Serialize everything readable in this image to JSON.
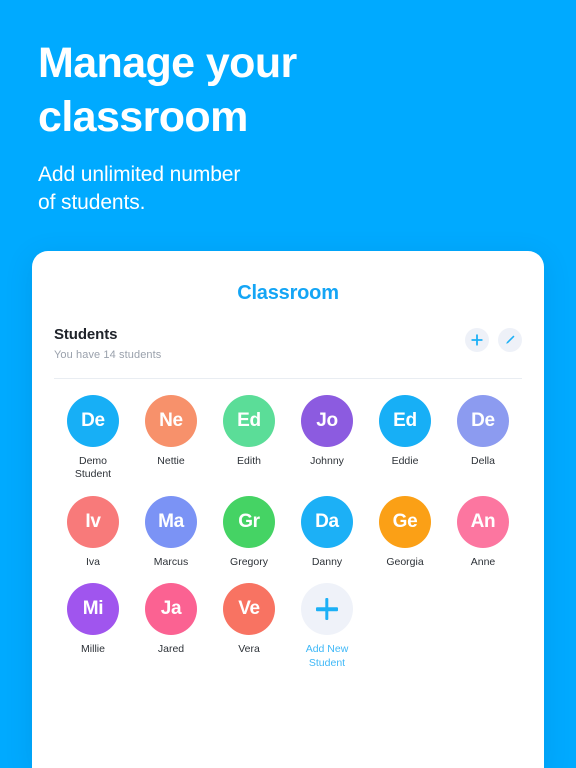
{
  "theme": {
    "background": "#00AAFF",
    "card_background": "#FFFFFF",
    "accent": "#14A5F5",
    "muted_text": "#9AA1AC"
  },
  "hero": {
    "title": "Manage your\nclassroom",
    "subtitle": "Add unlimited number\nof students."
  },
  "card": {
    "title": "Classroom",
    "section": {
      "heading": "Students",
      "subtext": "You have 14 students",
      "actions": [
        {
          "name": "add-student-button",
          "icon": "plus-icon",
          "color": "#1CB0F6"
        },
        {
          "name": "edit-students-button",
          "icon": "pencil-icon",
          "color": "#1CB0F6"
        }
      ]
    },
    "students": [
      {
        "initials": "De",
        "name": "Demo\nStudent",
        "color": "#17AFF6"
      },
      {
        "initials": "Ne",
        "name": "Nettie",
        "color": "#F7916B"
      },
      {
        "initials": "Ed",
        "name": "Edith",
        "color": "#5BDD98"
      },
      {
        "initials": "Jo",
        "name": "Johnny",
        "color": "#8C5BE0"
      },
      {
        "initials": "Ed",
        "name": "Eddie",
        "color": "#17AFF6"
      },
      {
        "initials": "De",
        "name": "Della",
        "color": "#8C9BF0"
      },
      {
        "initials": "Iv",
        "name": "Iva",
        "color": "#F87A7A"
      },
      {
        "initials": "Ma",
        "name": "Marcus",
        "color": "#7B93F5"
      },
      {
        "initials": "Gr",
        "name": "Gregory",
        "color": "#45D364"
      },
      {
        "initials": "Da",
        "name": "Danny",
        "color": "#1CB0F6"
      },
      {
        "initials": "Ge",
        "name": "Georgia",
        "color": "#FBA016"
      },
      {
        "initials": "An",
        "name": "Anne",
        "color": "#FC76A0"
      },
      {
        "initials": "Mi",
        "name": "Millie",
        "color": "#A055EE"
      },
      {
        "initials": "Ja",
        "name": "Jared",
        "color": "#FB6292"
      },
      {
        "initials": "Ve",
        "name": "Vera",
        "color": "#F87362"
      }
    ],
    "add_new": {
      "label": "Add New\nStudent",
      "icon": "plus-icon"
    }
  }
}
